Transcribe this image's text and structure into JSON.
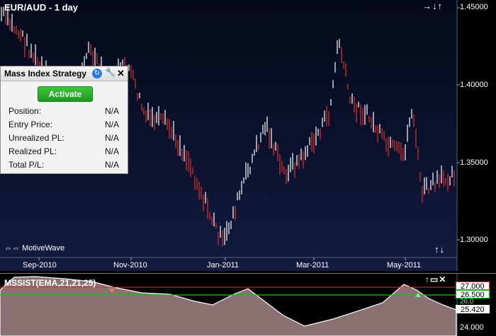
{
  "chart": {
    "title": "EUR/AUD - 1 day",
    "brand": "MotiveWave",
    "price_axis": [
      "1.45000",
      "1.40000",
      "1.35000",
      "1.30000"
    ],
    "date_axis": [
      "Sep-2010",
      "Nov-2010",
      "Jan-2011",
      "Mar-2011",
      "May-2011"
    ],
    "colors": {
      "up": "#ffffff",
      "down": "#e03030",
      "background": "#0c1230"
    }
  },
  "indicator": {
    "title": "MSSIST(EMA,21,21,25)",
    "levels": [
      "27.000",
      "26.500",
      "25.420",
      "24.000"
    ],
    "level_overlap": "26.0",
    "colors": {
      "upper": "#e03030",
      "lower": "#00cc00",
      "fill": "#8a7272"
    }
  },
  "panel": {
    "title": "Mass Index Strategy",
    "activate_label": "Activate",
    "rows": [
      {
        "label": "Position:",
        "value": "N/A"
      },
      {
        "label": "Entry Price:",
        "value": "N/A"
      },
      {
        "label": "Unrealized PL:",
        "value": "N/A"
      },
      {
        "label": "Realized PL:",
        "value": "N/A"
      },
      {
        "label": "Total P/L:",
        "value": "N/A"
      }
    ]
  },
  "icons": {
    "nav_top": "→↓↑",
    "nav_bottom": "↑↓",
    "nav_left": "⇔⇔",
    "ind_ctrl": "↑▭✕",
    "refresh": "↻",
    "wrench": "🔧",
    "close": "✕"
  }
}
